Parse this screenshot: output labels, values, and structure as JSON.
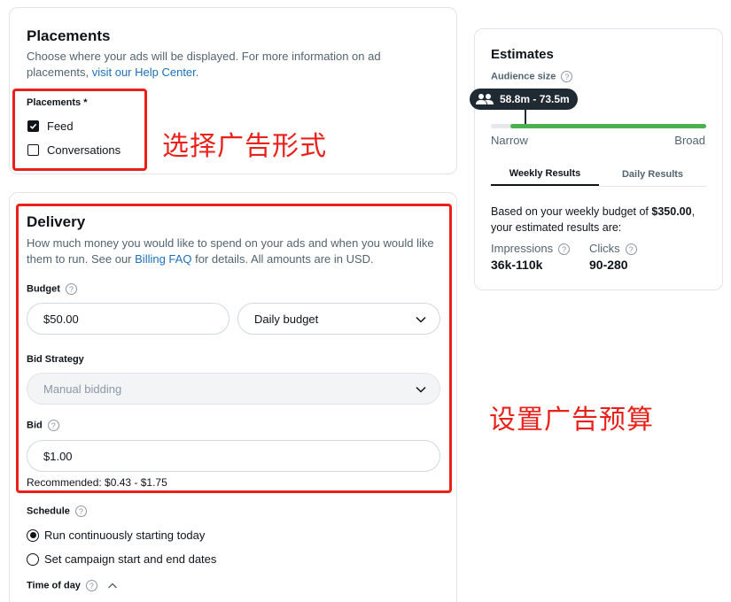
{
  "placements": {
    "title": "Placements",
    "desc_prefix": "Choose where your ads will be displayed. For more information on ad placements,",
    "help_link": "visit our Help Center",
    "desc_suffix": ".",
    "label": "Placements *",
    "options": [
      {
        "label": "Feed",
        "checked": true
      },
      {
        "label": "Conversations",
        "checked": false
      }
    ]
  },
  "delivery": {
    "title": "Delivery",
    "desc_prefix": "How much money you would like to spend on your ads and when you would like them to run. See our",
    "billing_link": "Billing FAQ",
    "desc_suffix": "for details. All amounts are in USD.",
    "budget_label": "Budget",
    "budget_value": "$50.00",
    "budget_type": "Daily budget",
    "bid_strategy_label": "Bid Strategy",
    "bid_strategy_value": "Manual bidding",
    "bid_label": "Bid",
    "bid_value": "$1.00",
    "recommended": "Recommended: $0.43 - $1.75",
    "schedule_label": "Schedule",
    "schedule_options": [
      {
        "label": "Run continuously starting today",
        "checked": true
      },
      {
        "label": "Set campaign start and end dates",
        "checked": false
      }
    ],
    "time_of_day_label": "Time of day"
  },
  "estimates": {
    "title": "Estimates",
    "audience_size_label": "Audience size",
    "audience_range": "58.8m - 73.5m",
    "audience_position": 0.09,
    "narrow_label": "Narrow",
    "broad_label": "Broad",
    "tabs": [
      {
        "label": "Weekly Results",
        "active": true
      },
      {
        "label": "Daily Results",
        "active": false
      }
    ],
    "summary_prefix": "Based on your weekly budget of",
    "summary_budget": "$350.00",
    "summary_suffix": ", your estimated results are:",
    "impressions_label": "Impressions",
    "impressions_value": "36k-110k",
    "clicks_label": "Clicks",
    "clicks_value": "90-280"
  },
  "annotations": {
    "placement_note": "选择广告形式",
    "budget_note": "设置广告预算"
  },
  "colors": {
    "accent_red": "#e8221b",
    "link_blue": "#1d6fb8",
    "range_green": "#4caf50",
    "tooltip_dark": "#1f2a33"
  }
}
